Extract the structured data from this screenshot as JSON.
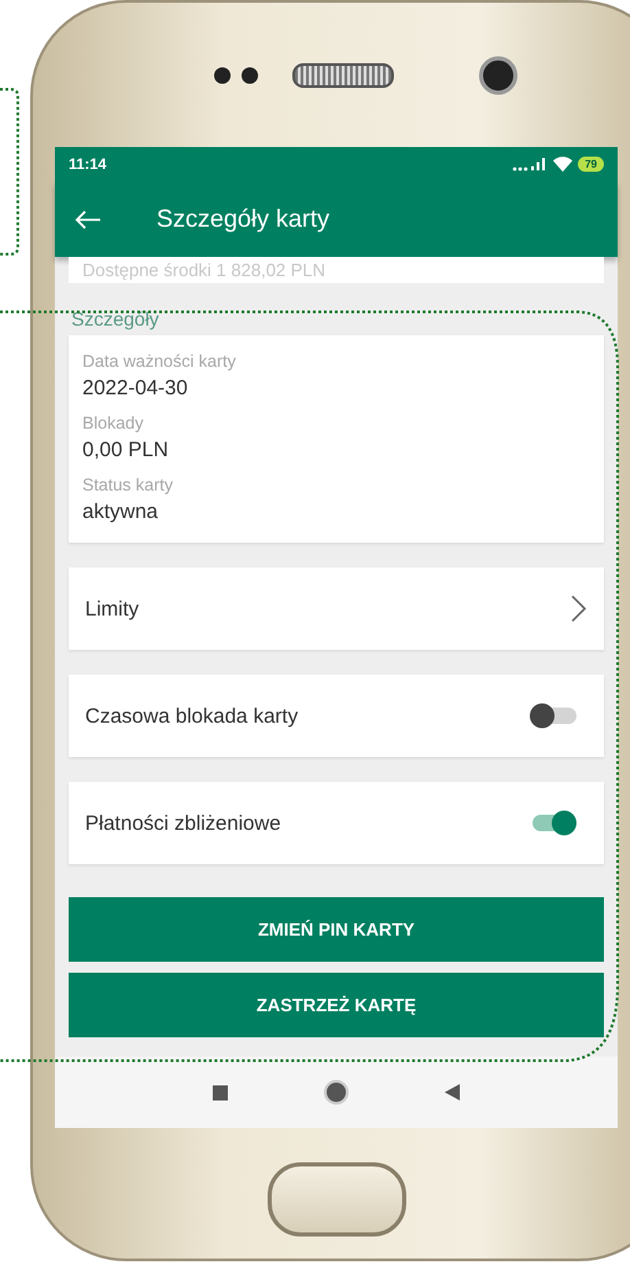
{
  "status_bar": {
    "time": "11:14",
    "battery": "79"
  },
  "toolbar": {
    "title": "Szczegóły karty"
  },
  "balance_line": "Dostępne środki 1 828,02 PLN",
  "section_title": "Szczegóły",
  "details": [
    {
      "label": "Data ważności karty",
      "value": "2022-04-30"
    },
    {
      "label": "Blokady",
      "value": "0,00 PLN"
    },
    {
      "label": "Status karty",
      "value": "aktywna"
    }
  ],
  "rows": [
    {
      "kind": "link",
      "label": "Limity"
    },
    {
      "kind": "toggle",
      "label": "Czasowa blokada karty",
      "on": false
    },
    {
      "kind": "toggle",
      "label": "Płatności zbliżeniowe",
      "on": true
    }
  ],
  "buttons": [
    "ZMIEŃ PIN KARTY",
    "ZASTRZEŻ KARTĘ"
  ]
}
